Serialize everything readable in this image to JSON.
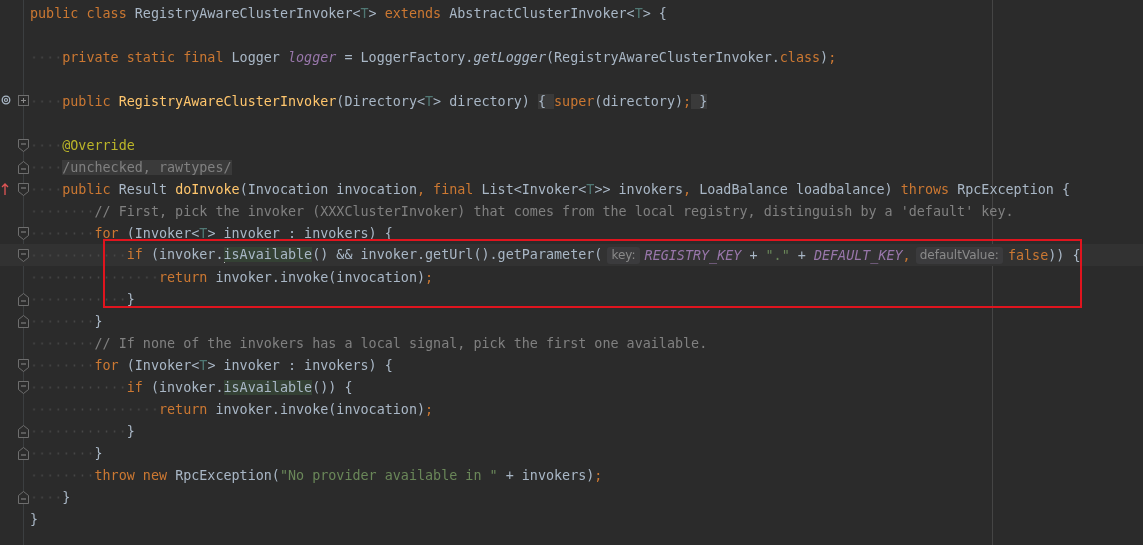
{
  "editor": {
    "lines": [
      {
        "current": false,
        "marked": false,
        "parts": [
          {
            "kind": "code",
            "tokens": [
              {
                "t": "public class ",
                "kind": "kw"
              },
              {
                "t": "RegistryAwareClusterInvoker<",
                "kind": "plain"
              },
              {
                "t": "T",
                "kind": "tparam"
              },
              {
                "t": "> ",
                "kind": "plain"
              },
              {
                "t": "extends ",
                "kind": "kw"
              },
              {
                "t": "AbstractClusterInvoker<",
                "kind": "plain"
              },
              {
                "t": "T",
                "kind": "tparam"
              },
              {
                "t": "> {",
                "kind": "plain"
              }
            ]
          }
        ]
      },
      {
        "current": false,
        "marked": false
      },
      {
        "current": false,
        "marked": false,
        "parts": [
          {
            "kind": "code",
            "tokens": [
              {
                "t": "    private static final ",
                "kind": "kw"
              },
              {
                "t": "Logger ",
                "kind": "plain"
              },
              {
                "t": "logger",
                "kind": "field"
              },
              {
                "t": " = LoggerFactory.",
                "kind": "plain"
              },
              {
                "t": "getLogger",
                "kind": "italic"
              },
              {
                "t": "(RegistryAwareClusterInvoker.",
                "kind": "plain"
              },
              {
                "t": "class",
                "kind": "kw"
              },
              {
                "t": ")",
                "kind": "plain"
              },
              {
                "t": ";",
                "kind": "kw"
              }
            ]
          }
        ]
      },
      {
        "current": false,
        "marked": false
      },
      {
        "current": false,
        "marked": false,
        "gutter": [
          {
            "kind": "override"
          },
          {
            "kind": "fold-collapsed"
          }
        ],
        "parts": [
          {
            "kind": "code",
            "tokens": [
              {
                "t": "    public ",
                "kind": "kw"
              },
              {
                "t": "RegistryAwareClusterInvoker",
                "kind": "decl"
              },
              {
                "t": "(Directory<",
                "kind": "plain"
              },
              {
                "t": "T",
                "kind": "tparam"
              },
              {
                "t": "> directory) ",
                "kind": "plain"
              },
              {
                "t": "{ ",
                "kind": "folded"
              },
              {
                "t": "super",
                "kind": "kw"
              },
              {
                "t": "(directory)",
                "kind": "plain"
              },
              {
                "t": ";",
                "kind": "kw"
              },
              {
                "t": " }",
                "kind": "folded"
              }
            ]
          }
        ]
      },
      {
        "current": false,
        "marked": false
      },
      {
        "current": false,
        "marked": false,
        "gutter": [
          {
            "kind": "fold-start"
          }
        ],
        "parts": [
          {
            "kind": "code",
            "tokens": [
              {
                "t": "    @Override",
                "kind": "anno"
              }
            ]
          }
        ]
      },
      {
        "current": false,
        "marked": false,
        "gutter": [
          {
            "kind": "fold-end"
          }
        ],
        "parts": [
          {
            "kind": "code",
            "tokens": [
              {
                "t": "    /unchecked, rawtypes/",
                "kind": "folded-comment"
              }
            ]
          }
        ]
      },
      {
        "current": false,
        "marked": false,
        "gutter": [
          {
            "kind": "up-arrow"
          },
          {
            "kind": "fold-start"
          }
        ],
        "parts": [
          {
            "kind": "code",
            "tokens": [
              {
                "t": "    public ",
                "kind": "kw"
              },
              {
                "t": "Result ",
                "kind": "plain"
              },
              {
                "t": "doInvoke",
                "kind": "decl"
              },
              {
                "t": "(Invocation invocation",
                "kind": "plain"
              },
              {
                "t": ", final ",
                "kind": "kw"
              },
              {
                "t": "List<Invoker<",
                "kind": "plain"
              },
              {
                "t": "T",
                "kind": "tparam"
              },
              {
                "t": ">> invokers",
                "kind": "plain"
              },
              {
                "t": ", ",
                "kind": "kw"
              },
              {
                "t": "LoadBalance loadbalance) ",
                "kind": "plain"
              },
              {
                "t": "throws ",
                "kind": "kw"
              },
              {
                "t": "RpcException {",
                "kind": "plain"
              }
            ]
          }
        ]
      },
      {
        "current": false,
        "marked": false,
        "parts": [
          {
            "kind": "code",
            "tokens": [
              {
                "t": "        // First, pick the invoker (XXXClusterInvoker) that comes from the local registry, distinguish by a 'default' key.",
                "kind": "comment"
              }
            ]
          }
        ]
      },
      {
        "current": false,
        "marked": false,
        "gutter": [
          {
            "kind": "fold-start"
          }
        ],
        "parts": [
          {
            "kind": "code",
            "tokens": [
              {
                "t": "        for ",
                "kind": "kw"
              },
              {
                "t": "(Invoker<",
                "kind": "plain"
              },
              {
                "t": "T",
                "kind": "tparam"
              },
              {
                "t": "> invoker : invokers) {",
                "kind": "plain"
              }
            ]
          }
        ]
      },
      {
        "current": true,
        "marked": true,
        "gutter": [
          {
            "kind": "fold-start"
          }
        ],
        "parts": [
          {
            "kind": "code",
            "tokens": [
              {
                "t": "            if ",
                "kind": "kw"
              },
              {
                "t": "(invoker.",
                "kind": "plain"
              },
              {
                "t": "isAvailable",
                "kind": "usage",
                "caret": true
              },
              {
                "t": "() && invoker.getUrl().getParameter(",
                "kind": "plain"
              }
            ]
          },
          {
            "kind": "hint",
            "text": "key:"
          },
          {
            "kind": "code",
            "tokens": [
              {
                "t": "REGISTRY_KEY",
                "kind": "const"
              },
              {
                "t": " + ",
                "kind": "plain"
              },
              {
                "t": "\".\"",
                "kind": "string"
              },
              {
                "t": " + ",
                "kind": "plain"
              },
              {
                "t": "DEFAULT_KEY",
                "kind": "const"
              },
              {
                "t": ",",
                "kind": "kw"
              }
            ]
          },
          {
            "kind": "hint",
            "text": "defaultValue:"
          },
          {
            "kind": "code",
            "tokens": [
              {
                "t": "false",
                "kind": "kw"
              },
              {
                "t": ")) {",
                "kind": "plain"
              }
            ]
          }
        ]
      },
      {
        "current": false,
        "marked": true,
        "parts": [
          {
            "kind": "code",
            "tokens": [
              {
                "t": "                return ",
                "kind": "kw"
              },
              {
                "t": "invoker.invoke(invocation)",
                "kind": "plain"
              },
              {
                "t": ";",
                "kind": "kw"
              }
            ]
          }
        ]
      },
      {
        "current": false,
        "marked": true,
        "gutter": [
          {
            "kind": "fold-end"
          }
        ],
        "parts": [
          {
            "kind": "code",
            "tokens": [
              {
                "t": "            }",
                "kind": "plain"
              }
            ]
          }
        ]
      },
      {
        "current": false,
        "marked": false,
        "gutter": [
          {
            "kind": "fold-end"
          }
        ],
        "parts": [
          {
            "kind": "code",
            "tokens": [
              {
                "t": "        }",
                "kind": "plain"
              }
            ]
          }
        ]
      },
      {
        "current": false,
        "marked": false,
        "parts": [
          {
            "kind": "code",
            "tokens": [
              {
                "t": "        // If none of the invokers has a local signal, pick the first one available.",
                "kind": "comment"
              }
            ]
          }
        ]
      },
      {
        "current": false,
        "marked": false,
        "gutter": [
          {
            "kind": "fold-start"
          }
        ],
        "parts": [
          {
            "kind": "code",
            "tokens": [
              {
                "t": "        for ",
                "kind": "kw"
              },
              {
                "t": "(Invoker<",
                "kind": "plain"
              },
              {
                "t": "T",
                "kind": "tparam"
              },
              {
                "t": "> invoker : invokers) {",
                "kind": "plain"
              }
            ]
          }
        ]
      },
      {
        "current": false,
        "marked": false,
        "gutter": [
          {
            "kind": "fold-start"
          }
        ],
        "parts": [
          {
            "kind": "code",
            "tokens": [
              {
                "t": "            if ",
                "kind": "kw"
              },
              {
                "t": "(invoker.",
                "kind": "plain"
              },
              {
                "t": "isAvailable",
                "kind": "usage"
              },
              {
                "t": "()) {",
                "kind": "plain"
              }
            ]
          }
        ]
      },
      {
        "current": false,
        "marked": false,
        "parts": [
          {
            "kind": "code",
            "tokens": [
              {
                "t": "                return ",
                "kind": "kw"
              },
              {
                "t": "invoker.invoke(invocation)",
                "kind": "plain"
              },
              {
                "t": ";",
                "kind": "kw"
              }
            ]
          }
        ]
      },
      {
        "current": false,
        "marked": false,
        "gutter": [
          {
            "kind": "fold-end"
          }
        ],
        "parts": [
          {
            "kind": "code",
            "tokens": [
              {
                "t": "            }",
                "kind": "plain"
              }
            ]
          }
        ]
      },
      {
        "current": false,
        "marked": false,
        "gutter": [
          {
            "kind": "fold-end"
          }
        ],
        "parts": [
          {
            "kind": "code",
            "tokens": [
              {
                "t": "        }",
                "kind": "plain"
              }
            ]
          }
        ]
      },
      {
        "current": false,
        "marked": false,
        "parts": [
          {
            "kind": "code",
            "tokens": [
              {
                "t": "        throw new ",
                "kind": "kw"
              },
              {
                "t": "RpcException(",
                "kind": "plain"
              },
              {
                "t": "\"No provider available in \"",
                "kind": "string"
              },
              {
                "t": " + invokers)",
                "kind": "plain"
              },
              {
                "t": ";",
                "kind": "kw"
              }
            ]
          }
        ]
      },
      {
        "current": false,
        "marked": false,
        "gutter": [
          {
            "kind": "fold-end"
          }
        ],
        "parts": [
          {
            "kind": "code",
            "tokens": [
              {
                "t": "    }",
                "kind": "plain"
              }
            ]
          }
        ]
      },
      {
        "current": false,
        "marked": false,
        "parts": [
          {
            "kind": "code",
            "tokens": [
              {
                "t": "}",
                "kind": "plain"
              }
            ]
          }
        ]
      }
    ]
  }
}
